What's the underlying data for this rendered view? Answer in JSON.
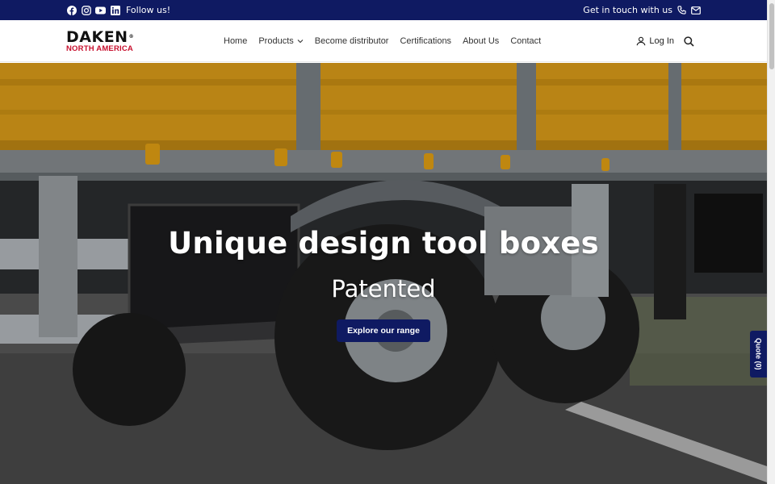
{
  "topbar": {
    "follow_label": "Follow us!",
    "social_icons": [
      "facebook-icon",
      "instagram-icon",
      "youtube-icon",
      "linkedin-icon"
    ],
    "contact_label": "Get in touch with us",
    "contact_icons": [
      "phone-icon",
      "mail-icon"
    ]
  },
  "logo": {
    "brand": "DAKEN",
    "region": "NORTH AMERICA",
    "brand_color": "#111111",
    "region_color": "#c8102e"
  },
  "nav": {
    "items": [
      {
        "label": "Home"
      },
      {
        "label": "Products"
      },
      {
        "label": "Become distributor"
      },
      {
        "label": "Certifications"
      },
      {
        "label": "About Us"
      },
      {
        "label": "Contact"
      }
    ]
  },
  "header_actions": {
    "login_label": "Log In",
    "icons": [
      "user-icon",
      "search-icon"
    ]
  },
  "hero": {
    "title": "Unique design tool boxes",
    "subtitle": "Patented",
    "cta_label": "Explore our range"
  },
  "quote_tab": {
    "label": "Quote (0)"
  },
  "colors": {
    "navy": "#0f1a62",
    "accent_yellow": "#e2a21a",
    "white": "#ffffff"
  }
}
